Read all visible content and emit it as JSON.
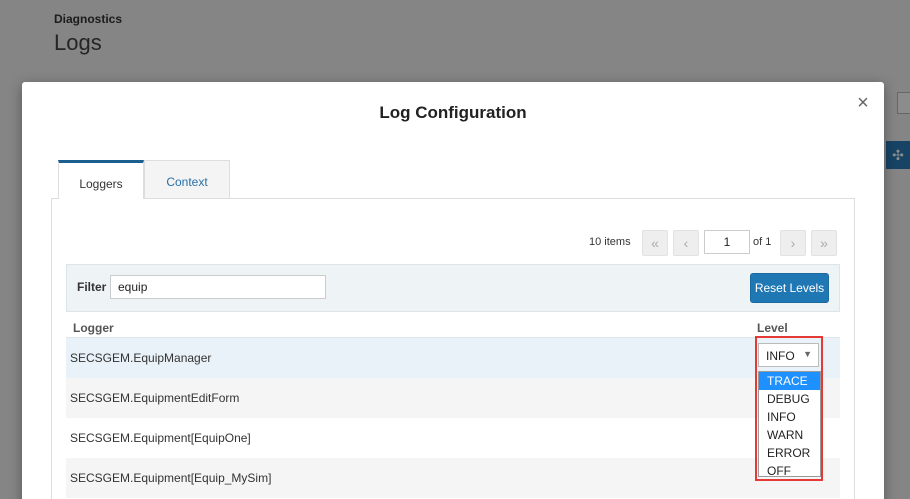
{
  "background": {
    "breadcrumb": "Diagnostics",
    "page_title": "Logs"
  },
  "modal": {
    "title": "Log Configuration",
    "close_label": "×"
  },
  "tabs": [
    {
      "label": "Loggers",
      "active": true
    },
    {
      "label": "Context",
      "active": false
    }
  ],
  "pager": {
    "items_count": "10 items",
    "first_label": "«",
    "prev_label": "‹",
    "current_page": "1",
    "of_label": "of 1",
    "next_label": "›",
    "last_label": "»"
  },
  "filter": {
    "label": "Filter",
    "value": "equip",
    "reset_label": "Reset Levels"
  },
  "table": {
    "headers": {
      "logger": "Logger",
      "level": "Level"
    },
    "rows": [
      {
        "logger": "SECSGEM.EquipManager",
        "level": "INFO"
      },
      {
        "logger": "SECSGEM.EquipmentEditForm",
        "level": ""
      },
      {
        "logger": "SECSGEM.Equipment[EquipOne]",
        "level": ""
      },
      {
        "logger": "SECSGEM.Equipment[Equip_MySim]",
        "level": ""
      }
    ]
  },
  "level_dropdown": {
    "selected": "INFO",
    "highlighted": "TRACE",
    "options": [
      "TRACE",
      "DEBUG",
      "INFO",
      "WARN",
      "ERROR",
      "OFF"
    ]
  },
  "colors": {
    "accent": "#1f78b4",
    "highlight_box": "#e53935",
    "dropdown_selected": "#1e90ff"
  },
  "icons": {
    "close": "close-icon",
    "caret": "chevron-down-icon",
    "side_button": "compress-icon"
  }
}
